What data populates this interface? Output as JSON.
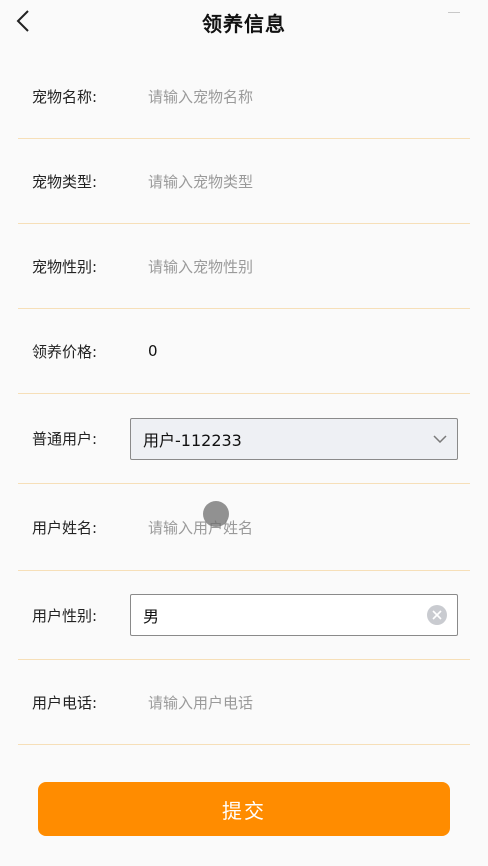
{
  "header": {
    "title": "领养信息",
    "back_icon": "chevron-left-icon"
  },
  "form": {
    "pet_name": {
      "label": "宠物名称:",
      "placeholder": "请输入宠物名称"
    },
    "pet_type": {
      "label": "宠物类型:",
      "placeholder": "请输入宠物类型"
    },
    "pet_gender": {
      "label": "宠物性别:",
      "placeholder": "请输入宠物性别"
    },
    "price": {
      "label": "领养价格:",
      "value": "0"
    },
    "user": {
      "label": "普通用户:",
      "selected": "用户-112233",
      "icon": "chevron-down-icon"
    },
    "user_name": {
      "label": "用户姓名:",
      "placeholder": "请输入用户姓名"
    },
    "user_gender": {
      "label": "用户性别:",
      "value": "男",
      "icon": "clear-icon"
    },
    "user_phone": {
      "label": "用户电话:",
      "placeholder": "请输入用户电话"
    }
  },
  "actions": {
    "submit_label": "提交"
  },
  "colors": {
    "accent": "#ff8c00",
    "divider": "#f6dfb8",
    "background": "#fafafa"
  }
}
